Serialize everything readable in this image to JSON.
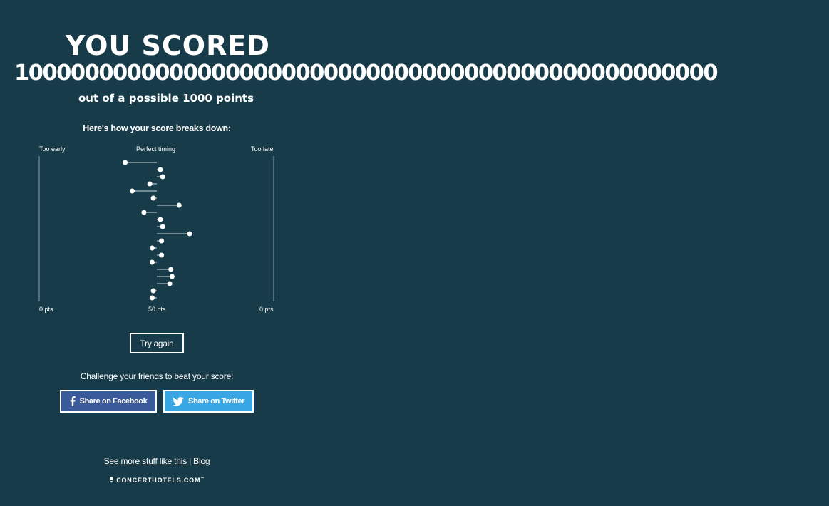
{
  "hero": {
    "title": "YOU SCORED",
    "score": "10000000000000000000000000000000000000000000000000",
    "subtitle": "out of a possible 1000 points"
  },
  "breakdown": {
    "title": "Here's how your score breaks down:",
    "axis_labels": {
      "left": "Too early",
      "center": "Perfect timing",
      "right": "Too late"
    },
    "points_labels": {
      "left": "0 pts",
      "center": "50 pts",
      "right": "0 pts"
    }
  },
  "chart_data": {
    "type": "scatter",
    "orientation": "horizontal lollipop",
    "description_axis": "timing offset per beat, negative = too early, positive = too late",
    "xlim": [
      -100,
      100
    ],
    "offsets": [
      -27,
      3,
      5,
      -6,
      -21,
      -3,
      19,
      -11,
      3,
      5,
      28,
      4,
      -4,
      4,
      -4,
      12,
      13,
      11,
      -3,
      -4
    ],
    "colors": {
      "dot": "#ffffff",
      "stem": "#8fa3ab",
      "axis": "#4f6e79"
    }
  },
  "actions": {
    "try_again": "Try again",
    "challenge": "Challenge your friends to beat your score:",
    "share_facebook": "Share on Facebook",
    "share_twitter": "Share on Twitter"
  },
  "footer": {
    "more_link": "See more stuff like this",
    "separator": "|",
    "blog_link": "Blog",
    "brand": "CONCERTHOTELS.COM",
    "brand_tm": "™"
  },
  "colors": {
    "background": "#173b49",
    "facebook": "#3b5a99",
    "twitter": "#38a7e3"
  }
}
